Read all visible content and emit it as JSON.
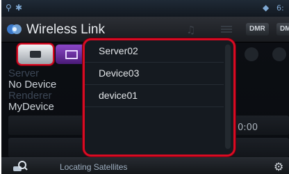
{
  "app": {
    "title": "Wireless Link"
  },
  "status_bar": {
    "time": "6:"
  },
  "header": {
    "dmr_buttons": [
      "DMR",
      "DM"
    ]
  },
  "info": {
    "server_label": "Server",
    "server_value": "No Device",
    "renderer_label": "Renderer",
    "renderer_value": "MyDevice"
  },
  "playback": {
    "time": "0:00"
  },
  "device_list": {
    "items": [
      "Server02",
      "Device03",
      "device01"
    ]
  },
  "bottom_bar": {
    "status": "Locating Satellites"
  },
  "colors": {
    "highlight": "#d80b22",
    "renderer_button": "#8c47c8"
  },
  "icons": [
    "usb-icon",
    "bluetooth-icon",
    "wifi-icon",
    "music-icon",
    "list-icon",
    "server-icon",
    "renderer-icon",
    "search-icon",
    "gear-icon"
  ]
}
